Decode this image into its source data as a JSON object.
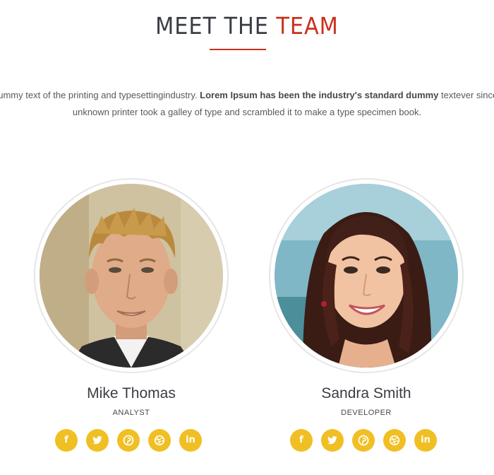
{
  "section": {
    "title_main": "MEET THE ",
    "title_accent": "TEAM",
    "intro_line1_before": "dummy text of the printing and typesettingindustry. ",
    "intro_line1_bold": "Lorem Ipsum has been the industry's standard dummy",
    "intro_line1_after": " textever since",
    "intro_line2": "unknown printer took a galley of type and scrambled it to make a type specimen book."
  },
  "team": [
    {
      "name": "Mike Thomas",
      "role": "ANALYST",
      "socials": [
        {
          "icon": "facebook-icon",
          "glyph": "f"
        },
        {
          "icon": "twitter-icon",
          "glyph": ""
        },
        {
          "icon": "pinterest-icon",
          "glyph": ""
        },
        {
          "icon": "dribbble-icon",
          "glyph": ""
        },
        {
          "icon": "linkedin-icon",
          "glyph": "in"
        }
      ]
    },
    {
      "name": "Sandra Smith",
      "role": "DEVELOPER",
      "socials": [
        {
          "icon": "facebook-icon",
          "glyph": "f"
        },
        {
          "icon": "twitter-icon",
          "glyph": ""
        },
        {
          "icon": "pinterest-icon",
          "glyph": ""
        },
        {
          "icon": "dribbble-icon",
          "glyph": ""
        },
        {
          "icon": "linkedin-icon",
          "glyph": "in"
        }
      ]
    }
  ],
  "colors": {
    "accent": "#c9321c",
    "social_bg": "#f0bf24",
    "heading": "#3a3d44",
    "body_text": "#555a61"
  }
}
